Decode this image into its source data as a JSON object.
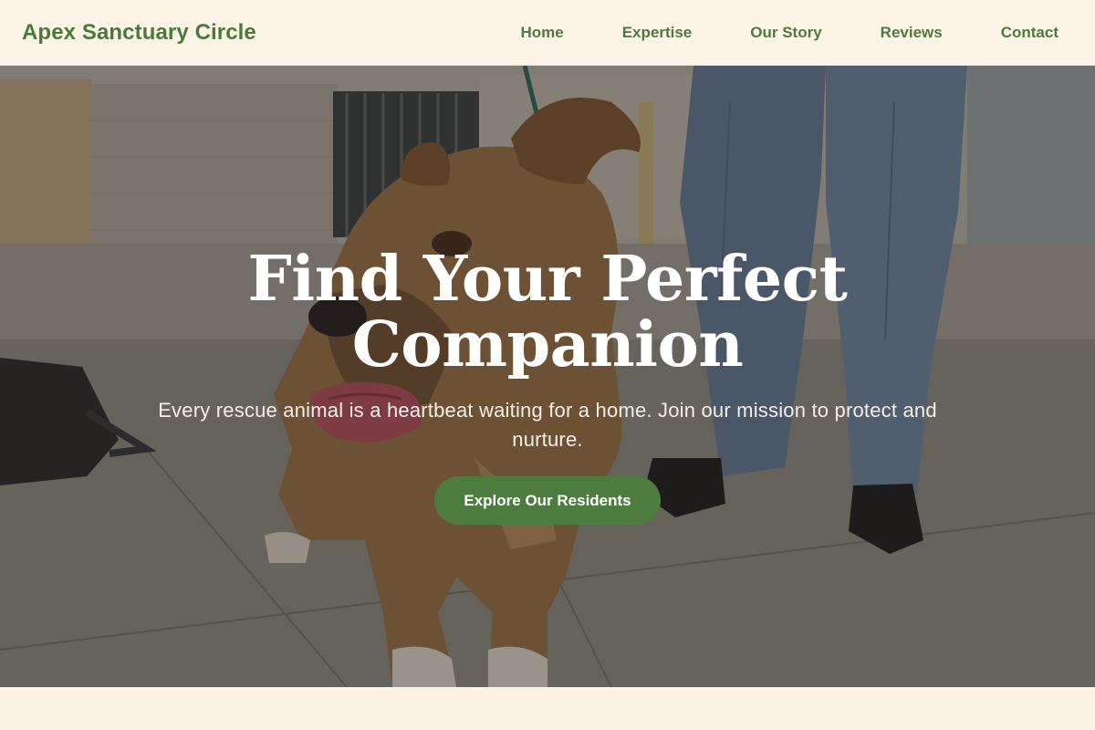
{
  "header": {
    "brand": "Apex Sanctuary Circle",
    "nav": [
      "Home",
      "Expertise",
      "Our Story",
      "Reviews",
      "Contact"
    ]
  },
  "hero": {
    "title": "Find Your Perfect Companion",
    "subtitle": "Every rescue animal is a heartbeat waiting for a home. Join our mission to protect and nurture.",
    "cta_label": "Explore Our Residents",
    "image_subject": "dog-with-person-photo"
  },
  "colors": {
    "accent": "#4d7d3e",
    "brand_text": "#4a7a3b",
    "background": "#fdf3e5"
  }
}
